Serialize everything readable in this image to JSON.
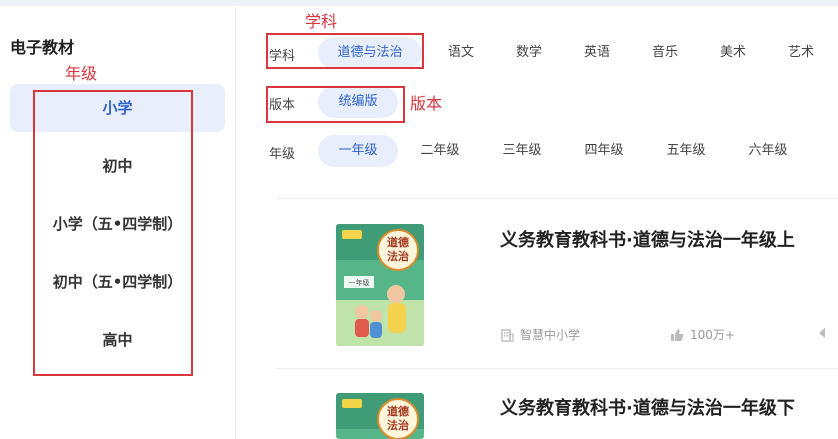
{
  "sidebar": {
    "title": "电子教材",
    "items": [
      {
        "label": "小学",
        "active": true
      },
      {
        "label": "初中",
        "active": false
      },
      {
        "label": "小学（五•四学制）",
        "active": false
      },
      {
        "label": "初中（五•四学制）",
        "active": false
      },
      {
        "label": "高中",
        "active": false
      }
    ]
  },
  "filters": {
    "subject": {
      "label": "学科",
      "options": [
        "道德与法治",
        "语文",
        "数学",
        "英语",
        "音乐",
        "美术",
        "艺术"
      ],
      "selected": "道德与法治"
    },
    "edition": {
      "label": "版本",
      "options": [
        "统编版"
      ],
      "selected": "统编版"
    },
    "grade": {
      "label": "年级",
      "options": [
        "一年级",
        "二年级",
        "三年级",
        "四年级",
        "五年级",
        "六年级"
      ],
      "selected": "一年级"
    }
  },
  "annotations": {
    "subject": "学科",
    "edition": "版本",
    "grade": "年级"
  },
  "books": [
    {
      "title": "义务教育教科书·道德与法治一年级上",
      "publisher": "智慧中小学",
      "likes": "100万+",
      "cover_text": "道德\n法治",
      "cover_grade": "一年级"
    },
    {
      "title": "义务教育教科书·道德与法治一年级下",
      "cover_text": "道德\n法治"
    }
  ],
  "colors": {
    "accent": "#2f63c7",
    "accent_bg": "#e8eefb",
    "annotation": "#d9363e"
  }
}
